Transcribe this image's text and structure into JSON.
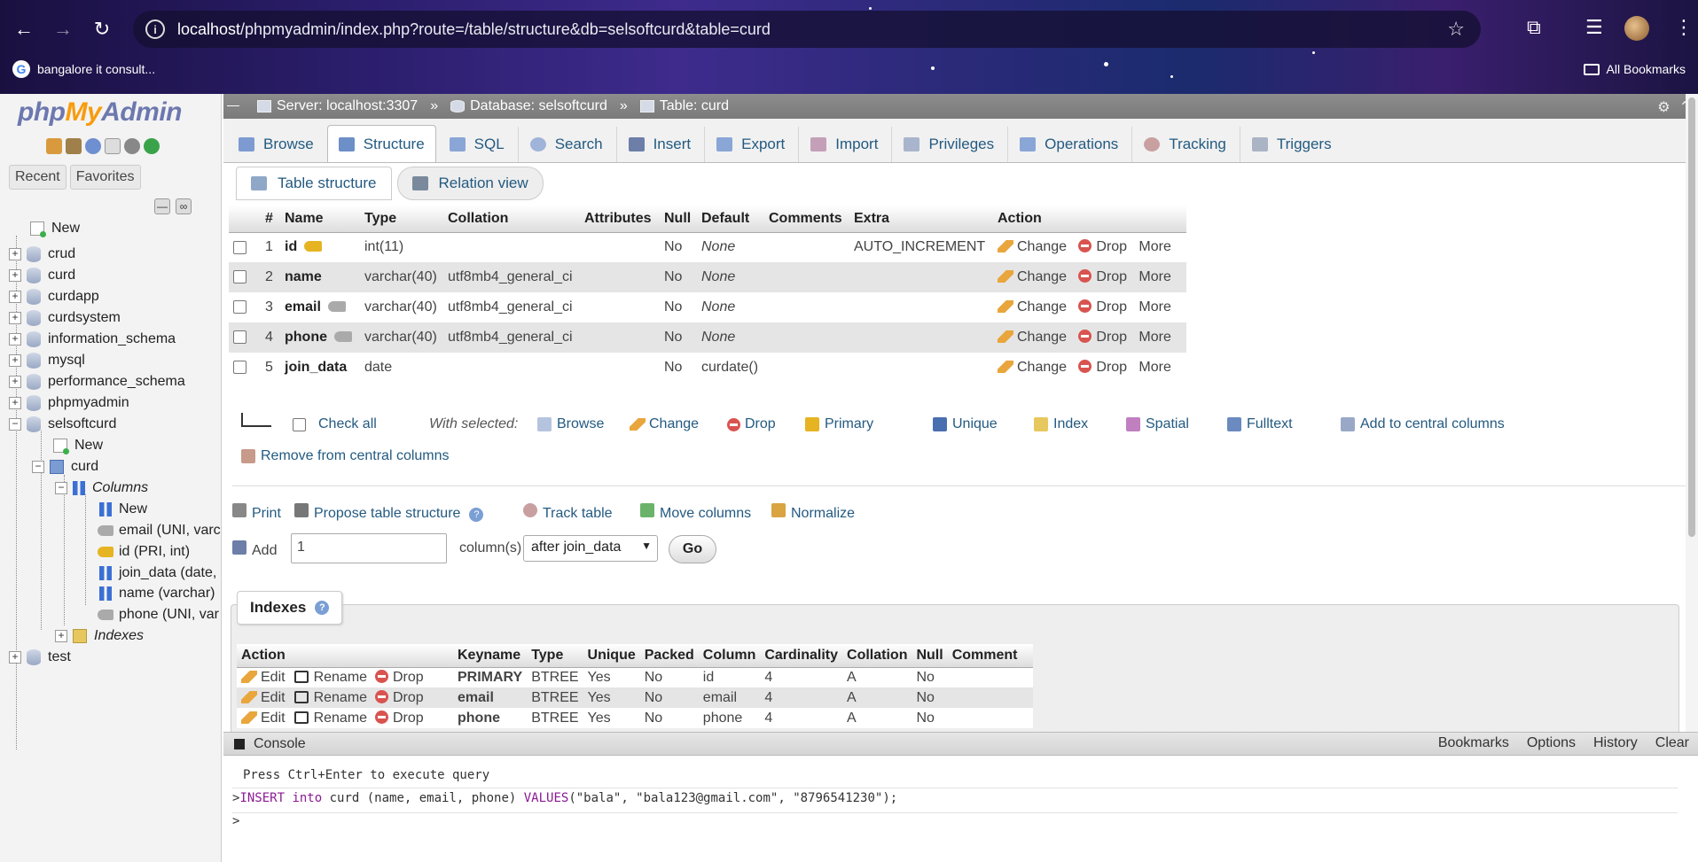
{
  "browser": {
    "url_host": "localhost",
    "url_path": "/phpmyadmin/index.php?route=/table/structure&db=selsoftcurd&table=curd",
    "bookmark_item": "bangalore it consult...",
    "all_bookmarks": "All Bookmarks"
  },
  "sidebar": {
    "logo": {
      "php": "php",
      "my": "My",
      "admin": "Admin"
    },
    "tabs": [
      "Recent",
      "Favorites"
    ],
    "tree": {
      "new": "New",
      "dbs": [
        "crud",
        "curd",
        "curdapp",
        "curdsystem",
        "information_schema",
        "mysql",
        "performance_schema",
        "phpmyadmin"
      ],
      "selsoftcurd": "selsoftcurd",
      "sel_new": "New",
      "table": "curd",
      "columns": "Columns",
      "col_new": "New",
      "cols": [
        "email (UNI, varc",
        "id (PRI, int)",
        "join_data (date,",
        "name (varchar)",
        "phone (UNI, var"
      ],
      "indexes": "Indexes",
      "test": "test"
    }
  },
  "breadcrumb": {
    "server": "Server: localhost:3307",
    "database": "Database: selsoftcurd",
    "table": "Table: curd",
    "sep": "»"
  },
  "menu": [
    "Browse",
    "Structure",
    "SQL",
    "Search",
    "Insert",
    "Export",
    "Import",
    "Privileges",
    "Operations",
    "Tracking",
    "Triggers"
  ],
  "subtabs": {
    "structure": "Table structure",
    "relation": "Relation view"
  },
  "structure": {
    "headers": [
      "",
      "#",
      "Name",
      "Type",
      "Collation",
      "Attributes",
      "Null",
      "Default",
      "Comments",
      "Extra",
      "Action"
    ],
    "rows": [
      {
        "num": "1",
        "name": "id",
        "key": "primary",
        "type": "int(11)",
        "collation": "",
        "null": "No",
        "default": "None",
        "extra": "AUTO_INCREMENT"
      },
      {
        "num": "2",
        "name": "name",
        "key": "",
        "type": "varchar(40)",
        "collation": "utf8mb4_general_ci",
        "null": "No",
        "default": "None",
        "extra": ""
      },
      {
        "num": "3",
        "name": "email",
        "key": "unique",
        "type": "varchar(40)",
        "collation": "utf8mb4_general_ci",
        "null": "No",
        "default": "None",
        "extra": ""
      },
      {
        "num": "4",
        "name": "phone",
        "key": "unique",
        "type": "varchar(40)",
        "collation": "utf8mb4_general_ci",
        "null": "No",
        "default": "None",
        "extra": ""
      },
      {
        "num": "5",
        "name": "join_data",
        "key": "",
        "type": "date",
        "collation": "",
        "null": "No",
        "default": "curdate()",
        "extra": ""
      }
    ],
    "actions": {
      "change": "Change",
      "drop": "Drop",
      "more": "More"
    }
  },
  "with_selected": {
    "check_all": "Check all",
    "label": "With selected:",
    "items": [
      "Browse",
      "Change",
      "Drop",
      "Primary",
      "Unique",
      "Index",
      "Spatial",
      "Fulltext",
      "Add to central columns"
    ],
    "remove_central": "Remove from central columns"
  },
  "tools": {
    "print": "Print",
    "propose": "Propose table structure",
    "track": "Track table",
    "move": "Move columns",
    "normalize": "Normalize"
  },
  "add_columns": {
    "label": "Add",
    "value": "1",
    "suffix": "column(s)",
    "position": "after join_data",
    "go": "Go"
  },
  "indexes": {
    "title": "Indexes",
    "headers": [
      "Action",
      "Keyname",
      "Type",
      "Unique",
      "Packed",
      "Column",
      "Cardinality",
      "Collation",
      "Null",
      "Comment"
    ],
    "actions": {
      "edit": "Edit",
      "rename": "Rename",
      "drop": "Drop"
    },
    "rows": [
      {
        "keyname": "PRIMARY",
        "type": "BTREE",
        "unique": "Yes",
        "packed": "No",
        "column": "id",
        "cardinality": "4",
        "collation": "A",
        "null": "No",
        "comment": ""
      },
      {
        "keyname": "email",
        "type": "BTREE",
        "unique": "Yes",
        "packed": "No",
        "column": "email",
        "cardinality": "4",
        "collation": "A",
        "null": "No",
        "comment": ""
      },
      {
        "keyname": "phone",
        "type": "BTREE",
        "unique": "Yes",
        "packed": "No",
        "column": "phone",
        "cardinality": "4",
        "collation": "A",
        "null": "No",
        "comment": ""
      }
    ]
  },
  "console": {
    "title": "Console",
    "links": [
      "Bookmarks",
      "Options",
      "History",
      "Clear"
    ],
    "hint": "Press Ctrl+Enter to execute query",
    "query": {
      "k1": "INSERT",
      "k2": "into",
      "t1": " curd (name, email, phone) ",
      "k3": "VALUES",
      "t2": "(\"bala\", \"bala123@gmail.com\", \"8796541230\");"
    },
    "prompt": ">"
  }
}
